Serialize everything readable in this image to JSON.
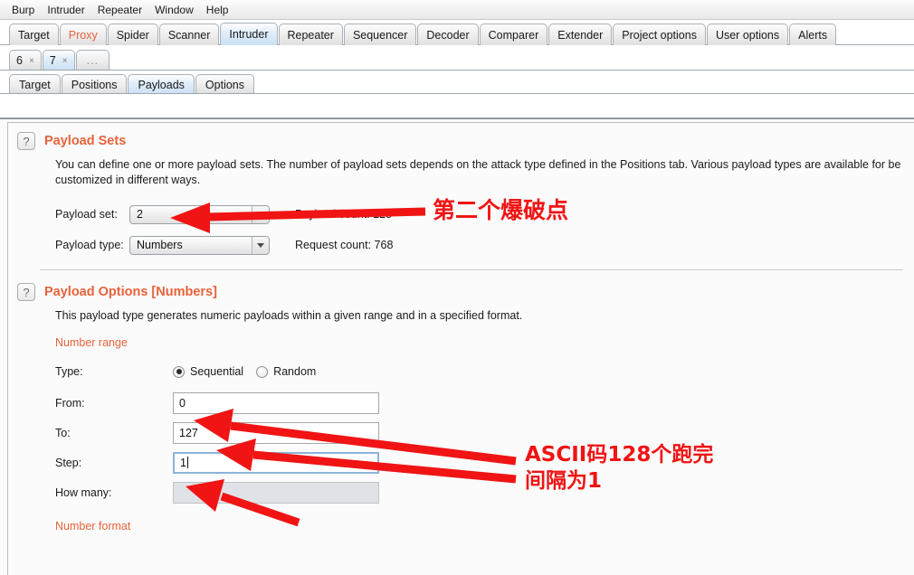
{
  "menu": {
    "items": [
      "Burp",
      "Intruder",
      "Repeater",
      "Window",
      "Help"
    ]
  },
  "main_tabs": [
    {
      "label": "Target",
      "selected": false
    },
    {
      "label": "Proxy",
      "selected": false
    },
    {
      "label": "Spider",
      "selected": false
    },
    {
      "label": "Scanner",
      "selected": false
    },
    {
      "label": "Intruder",
      "selected": true
    },
    {
      "label": "Repeater",
      "selected": false
    },
    {
      "label": "Sequencer",
      "selected": false
    },
    {
      "label": "Decoder",
      "selected": false
    },
    {
      "label": "Comparer",
      "selected": false
    },
    {
      "label": "Extender",
      "selected": false
    },
    {
      "label": "Project options",
      "selected": false
    },
    {
      "label": "User options",
      "selected": false
    },
    {
      "label": "Alerts",
      "selected": false
    }
  ],
  "attack_tabs": [
    {
      "label": "6",
      "close": "×",
      "selected": false
    },
    {
      "label": "7",
      "close": "×",
      "selected": true
    },
    {
      "label": "...",
      "close": "",
      "selected": false
    }
  ],
  "sub_tabs": [
    {
      "label": "Target",
      "selected": false
    },
    {
      "label": "Positions",
      "selected": false
    },
    {
      "label": "Payloads",
      "selected": true
    },
    {
      "label": "Options",
      "selected": false
    }
  ],
  "payload_sets": {
    "help_glyph": "?",
    "title": "Payload Sets",
    "description": "You can define one or more payload sets. The number of payload sets depends on the attack type defined in the Positions tab. Various payload types are available for be customized in different ways.",
    "payload_set_label": "Payload set:",
    "payload_set_value": "2",
    "payload_type_label": "Payload type:",
    "payload_type_value": "Numbers",
    "payload_count_text": "Payload count: 128",
    "request_count_text": "Request count: 768"
  },
  "payload_options": {
    "help_glyph": "?",
    "title": "Payload Options [Numbers]",
    "description": "This payload type generates numeric payloads within a given range and in a specified format.",
    "number_range_heading": "Number range",
    "type_label": "Type:",
    "type_sequential": "Sequential",
    "type_random": "Random",
    "type_selected": "Sequential",
    "from_label": "From:",
    "from_value": "0",
    "to_label": "To:",
    "to_value": "127",
    "step_label": "Step:",
    "step_value": "1",
    "how_many_label": "How many:",
    "how_many_value": "",
    "number_format_heading": "Number format"
  },
  "annotations": {
    "color": "#f01414",
    "note_payload_set": "第二个爆破点",
    "note_range_line1": "ASCII码128个跑完",
    "note_range_line2": "间隔为1"
  }
}
